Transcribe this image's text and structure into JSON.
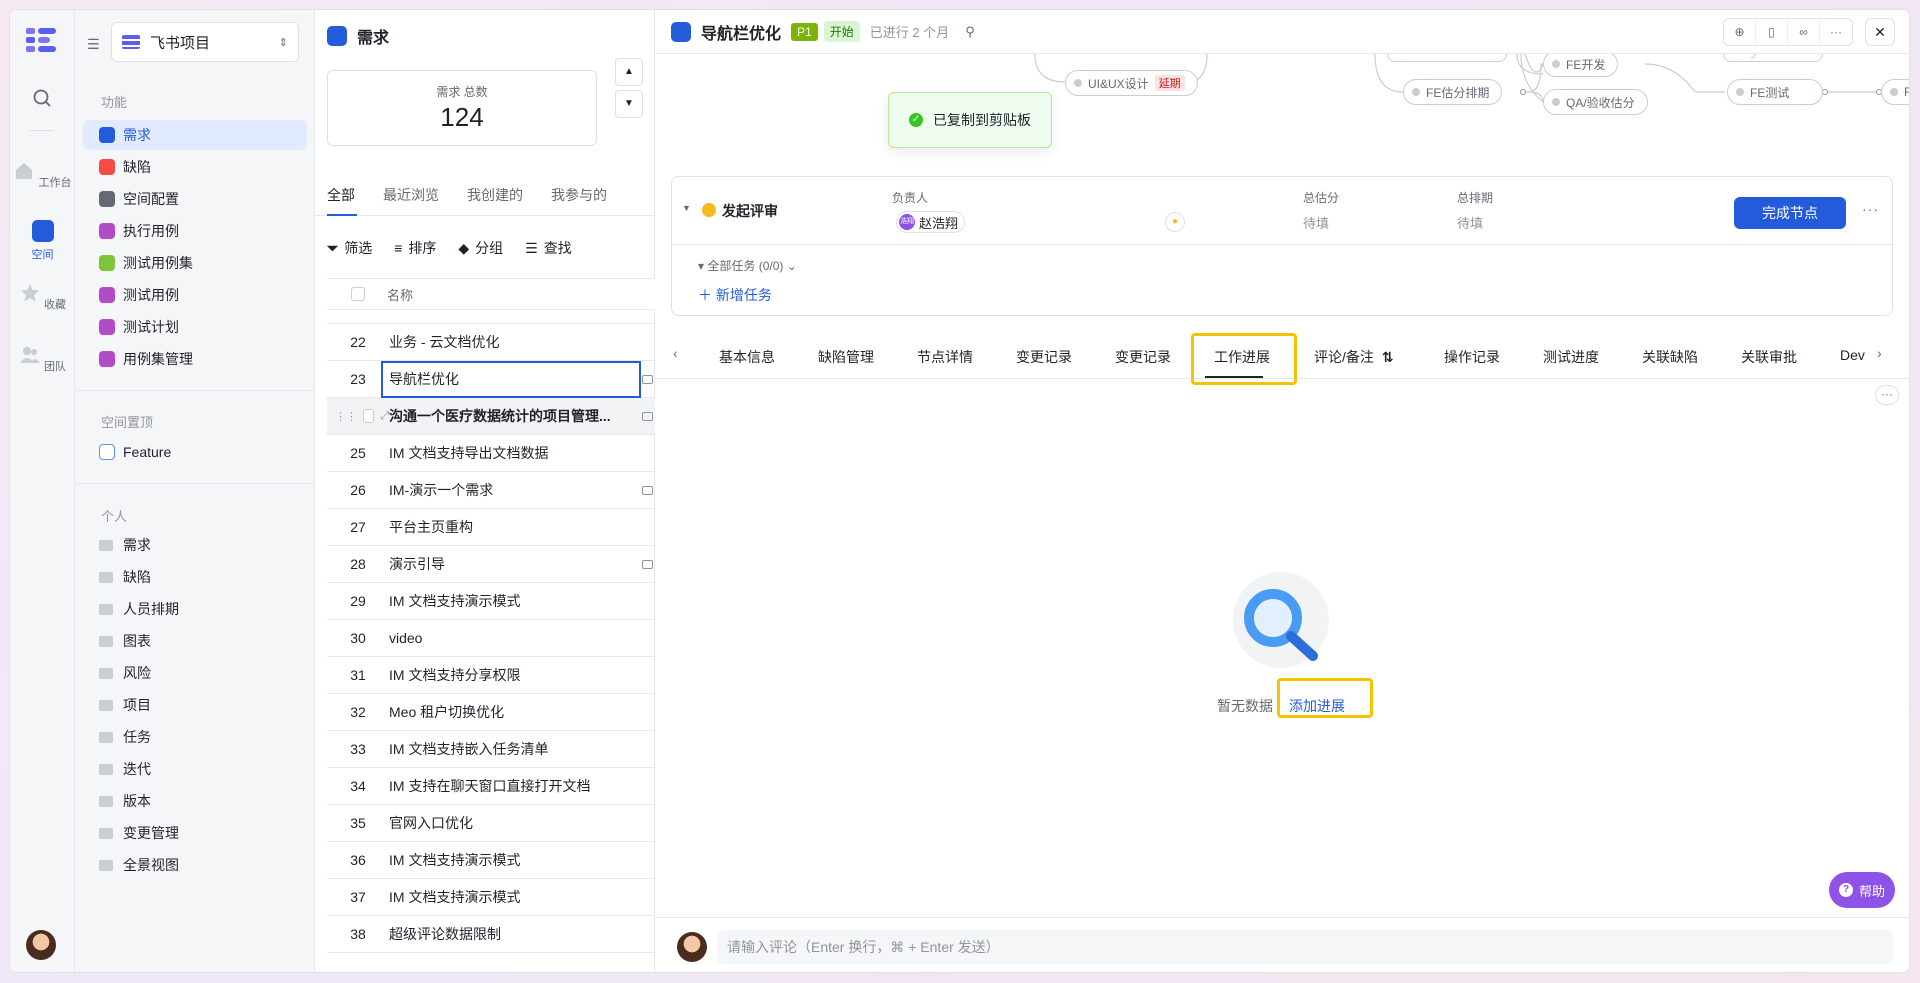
{
  "rail": {
    "items": [
      {
        "label": "工作台"
      },
      {
        "label": "空间"
      },
      {
        "label": "收藏"
      },
      {
        "label": "团队"
      }
    ]
  },
  "sidebar": {
    "project": "飞书项目",
    "section_features": "功能",
    "features": [
      {
        "label": "需求",
        "color": "#245bdb"
      },
      {
        "label": "缺陷",
        "color": "#f54a45"
      },
      {
        "label": "空间配置",
        "color": "#646a73"
      },
      {
        "label": "执行用例",
        "color": "#b44bc6"
      },
      {
        "label": "测试用例集",
        "color": "#7cc53a"
      },
      {
        "label": "测试用例",
        "color": "#b44bc6"
      },
      {
        "label": "测试计划",
        "color": "#b44bc6"
      },
      {
        "label": "用例集管理",
        "color": "#b44bc6"
      }
    ],
    "section_pinned": "空间置顶",
    "pinned": [
      {
        "label": "Feature"
      }
    ],
    "section_personal": "个人",
    "personal": [
      "需求",
      "缺陷",
      "人员排期",
      "图表",
      "风险",
      "项目",
      "任务",
      "迭代",
      "版本",
      "变更管理",
      "全景视图"
    ]
  },
  "list": {
    "header": "需求",
    "stat_label": "需求 总数",
    "stat_value": "124",
    "tabs": [
      "全部",
      "最近浏览",
      "我创建的",
      "我参与的"
    ],
    "toolbar": {
      "filter": "筛选",
      "sort": "排序",
      "group": "分组",
      "find": "查找"
    },
    "column_name": "名称",
    "rows": [
      {
        "no": "22",
        "title": "业务 - 云文档优化"
      },
      {
        "no": "23",
        "title": "导航栏优化"
      },
      {
        "no": "",
        "title": "沟通一个医疗数据统计的项目管理..."
      },
      {
        "no": "25",
        "title": "IM 文档支持导出文档数据"
      },
      {
        "no": "26",
        "title": "IM-演示一个需求"
      },
      {
        "no": "27",
        "title": "平台主页重构"
      },
      {
        "no": "28",
        "title": "演示引导"
      },
      {
        "no": "29",
        "title": "IM 文档支持演示模式"
      },
      {
        "no": "30",
        "title": "video"
      },
      {
        "no": "31",
        "title": "IM 文档支持分享权限"
      },
      {
        "no": "32",
        "title": "Meo 租户切换优化"
      },
      {
        "no": "33",
        "title": "IM 文档支持嵌入任务清单"
      },
      {
        "no": "34",
        "title": "IM 支持在聊天窗口直接打开文档"
      },
      {
        "no": "35",
        "title": "官网入口优化"
      },
      {
        "no": "36",
        "title": "IM 文档支持演示模式"
      },
      {
        "no": "37",
        "title": "IM 文档支持演示模式"
      },
      {
        "no": "38",
        "title": "超级评论数据限制"
      }
    ]
  },
  "detail": {
    "title": "导航栏优化",
    "priority": "P1",
    "status": "开始",
    "elapsed": "已进行 2 个月",
    "toast": "已复制到剪贴板",
    "flow_nodes": [
      {
        "label": "UI&UX设计",
        "tag": "延期"
      },
      {
        "label": "FE开发"
      },
      {
        "label": "FE估分排期"
      },
      {
        "label": "QA/验收估分"
      },
      {
        "label": "FE测试"
      },
      {
        "label": "FE"
      }
    ],
    "node": {
      "name": "发起评审",
      "owner_label": "负责人",
      "owner": "赵浩翔",
      "owner_initials": "浩翔",
      "estimate_label": "总估分",
      "estimate_value": "待填",
      "schedule_label": "总排期",
      "schedule_value": "待填",
      "complete_button": "完成节点",
      "tasks": "全部任务 (0/0)",
      "add_task": "新增任务"
    },
    "tabs": [
      "基本信息",
      "缺陷管理",
      "节点详情",
      "变更记录",
      "变更记录",
      "工作进展",
      "评论/备注",
      "操作记录",
      "测试进度",
      "关联缺陷",
      "关联审批",
      "Dev"
    ],
    "active_tab": "工作进展",
    "empty_text": "暂无数据",
    "add_progress": "添加进展",
    "help": "帮助",
    "comment_placeholder": "请输入评论（Enter 换行，⌘ + Enter 发送）"
  }
}
